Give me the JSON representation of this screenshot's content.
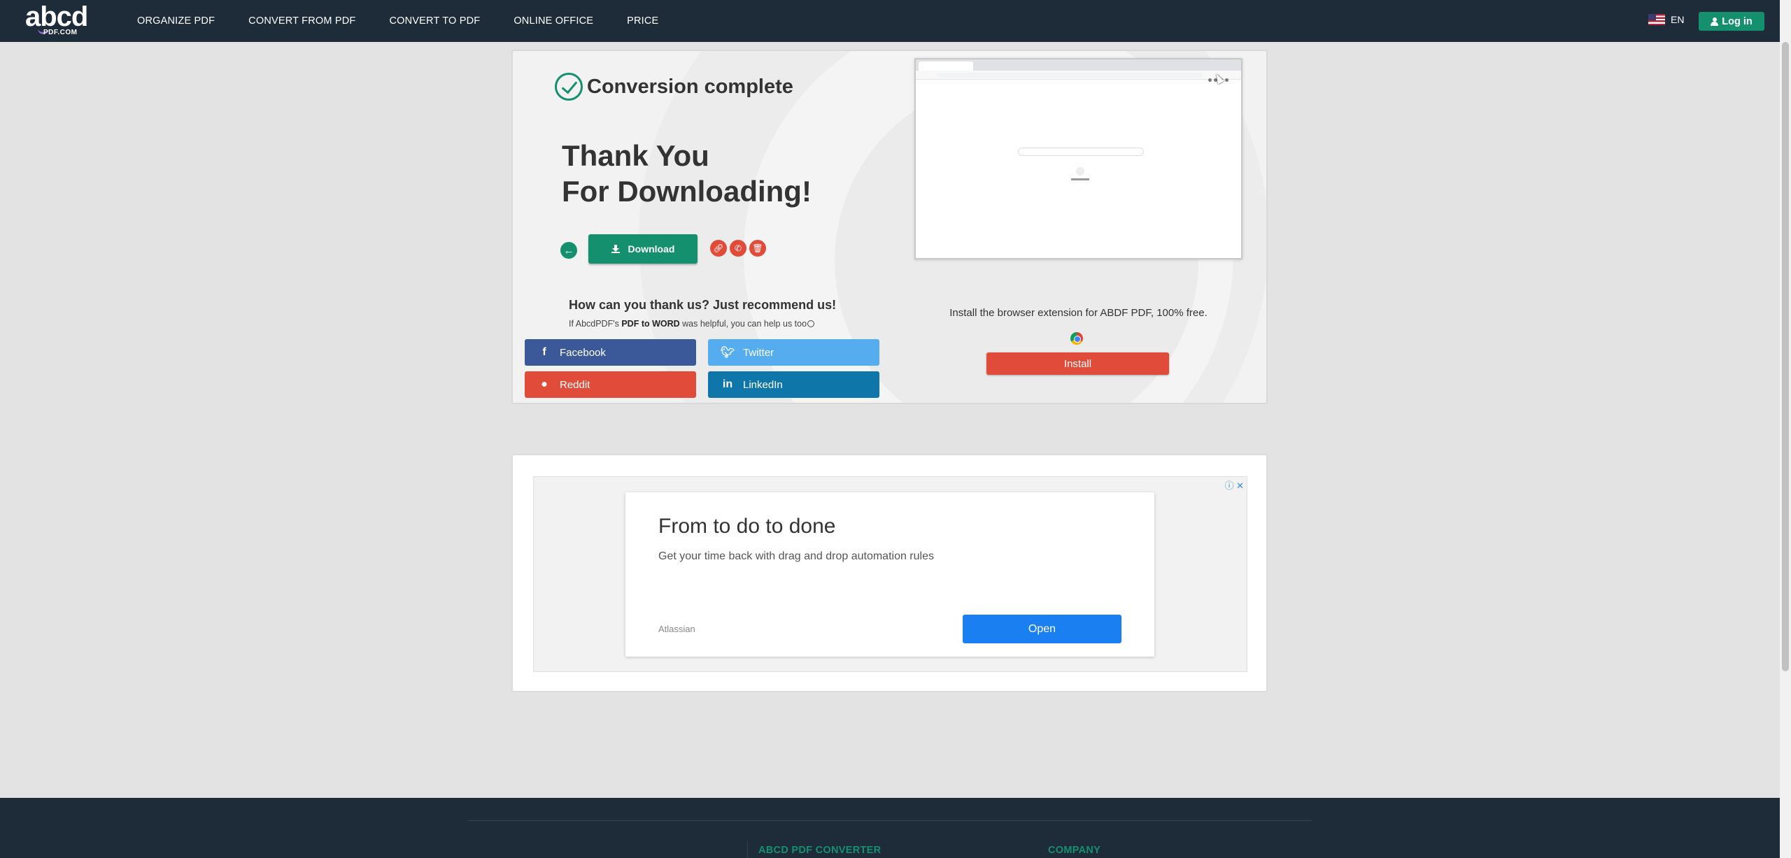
{
  "nav": {
    "logo_text": "abcd",
    "logo_sub": "PDF.COM",
    "menu": [
      "ORGANIZE PDF",
      "CONVERT FROM PDF",
      "CONVERT TO PDF",
      "ONLINE OFFICE",
      "PRICE"
    ],
    "language": "EN",
    "login": "Log in"
  },
  "result": {
    "status": "Conversion complete",
    "thanks_line1": "Thank You",
    "thanks_line2": "For Downloading!",
    "download_label": "Download",
    "back_icon": "arrow-left-icon",
    "action_icons": [
      "link-icon",
      "whatsapp-icon",
      "trash-icon"
    ]
  },
  "recommend": {
    "title": "How can you thank us? Just recommend us!",
    "sub_pre": "If AbcdPDF's ",
    "sub_bold": "PDF to WORD",
    "sub_post": " was helpful, you can help us too"
  },
  "social": {
    "facebook": "Facebook",
    "twitter": "Twitter",
    "reddit": "Reddit",
    "linkedin": "LinkedIn"
  },
  "extension": {
    "text": "Install the browser extension for ABDF PDF, 100% free.",
    "install": "Install",
    "browser_icon": "chrome-icon"
  },
  "ad": {
    "headline": "From to do to done",
    "body": "Get your time back with drag and drop automation rules",
    "advertiser": "Atlassian",
    "cta": "Open",
    "info": "ⓘ ✕"
  },
  "footer": {
    "col1": "ABCD PDF CONVERTER",
    "col2": "COMPANY"
  },
  "colors": {
    "nav_bg": "#1e2b39",
    "brand_green": "#14906e",
    "accent_red": "#e14c3a",
    "facebook": "#3b5999",
    "twitter": "#55acee",
    "linkedin": "#0e76a8",
    "ad_button": "#1a7ff0"
  }
}
